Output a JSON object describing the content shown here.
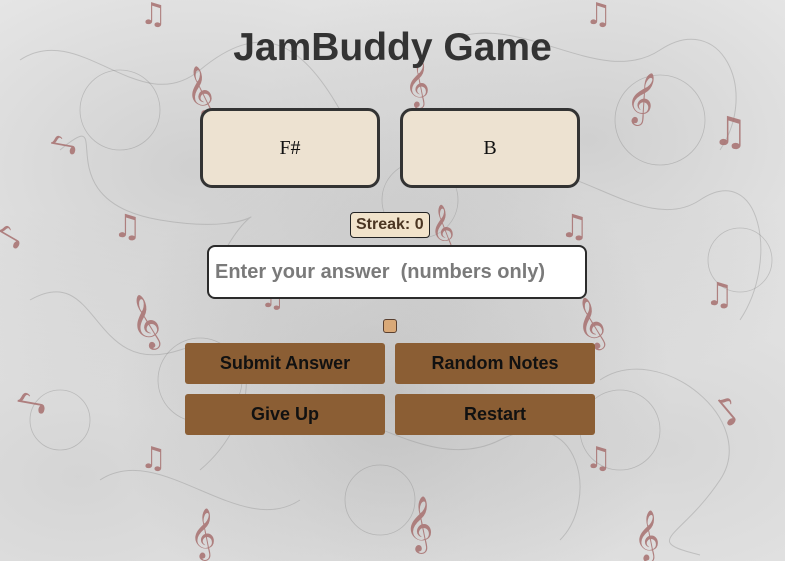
{
  "title": "JamBuddy Game",
  "notes": {
    "first": "F#",
    "second": "B"
  },
  "streak": {
    "label": "Streak: 0"
  },
  "answer": {
    "placeholder": "Enter your answer  (numbers only)",
    "value": ""
  },
  "buttons": {
    "submit": "Submit Answer",
    "random": "Random Notes",
    "give_up": "Give Up",
    "restart": "Restart"
  },
  "background": {
    "decor_icon": "music-notes-icon",
    "note_color": "#a7706f"
  },
  "colors": {
    "note_box_bg": "#ede2d1",
    "button_bg": "#8b5e34",
    "streak_bg": "#f1e3cb",
    "title": "#333333"
  }
}
